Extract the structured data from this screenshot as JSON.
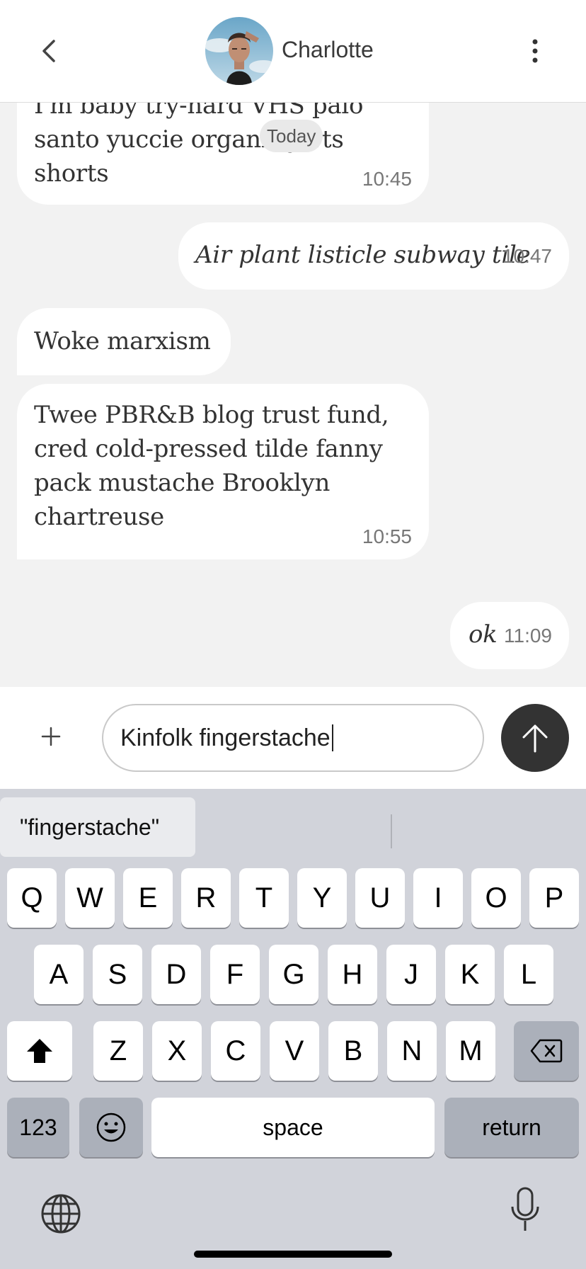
{
  "header": {
    "contact_name": "Charlotte",
    "back_icon": "chevron-left-icon",
    "more_icon": "more-vertical-icon"
  },
  "chat": {
    "date_pill": "Today",
    "messages": [
      {
        "direction": "in",
        "text_lines": [
          "I'm baby try-hard VHS palo",
          "santo yuccie organic jorts shorts"
        ],
        "time": "10:45"
      },
      {
        "direction": "out",
        "text": "Air plant listicle subway tile",
        "time": "10:47"
      },
      {
        "direction": "in",
        "text": "Woke marxism",
        "time": ""
      },
      {
        "direction": "in",
        "text_lines": [
          "Twee PBR&B blog trust fund,",
          "cred cold-pressed tilde fanny",
          "pack mustache Brooklyn",
          "chartreuse"
        ],
        "time": "10:55"
      },
      {
        "direction": "out",
        "text": "ok",
        "time": "11:09"
      }
    ]
  },
  "composer": {
    "value": "Kinfolk fingerstache",
    "plus_icon": "plus-icon",
    "send_icon": "arrow-up-icon"
  },
  "keyboard": {
    "suggestion": "\"fingerstache\"",
    "row1": [
      "Q",
      "W",
      "E",
      "R",
      "T",
      "Y",
      "U",
      "I",
      "O",
      "P"
    ],
    "row2": [
      "A",
      "S",
      "D",
      "F",
      "G",
      "H",
      "J",
      "K",
      "L"
    ],
    "row3": [
      "Z",
      "X",
      "C",
      "V",
      "B",
      "N",
      "M"
    ],
    "numbers_key": "123",
    "space_key": "space",
    "return_key": "return"
  },
  "colors": {
    "send_button": "#333333",
    "bubble": "#ffffff",
    "chat_background": "#f2f2f2",
    "keyboard_background": "#d1d3da"
  }
}
